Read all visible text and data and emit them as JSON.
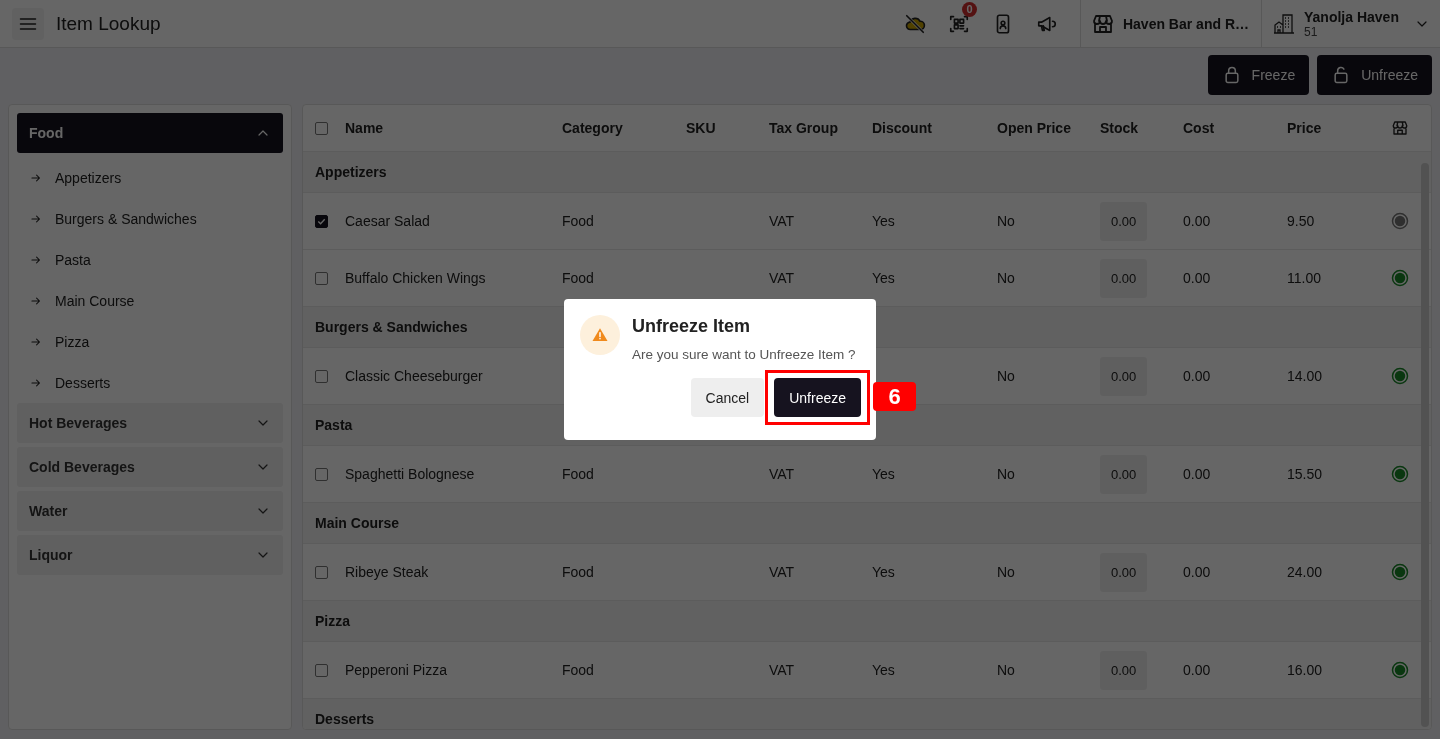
{
  "header": {
    "title": "Item Lookup",
    "notification_count": "0",
    "store": "Haven Bar and R…",
    "account": {
      "name": "Yanolja Haven",
      "number": "51"
    }
  },
  "actions": [
    {
      "label": "Freeze",
      "kind": "lock"
    },
    {
      "label": "Unfreeze",
      "kind": "unlock"
    }
  ],
  "sidebar": {
    "categories": [
      {
        "label": "Food",
        "selected": true,
        "expanded": true,
        "children": [
          {
            "label": "Appetizers"
          },
          {
            "label": "Burgers & Sandwiches"
          },
          {
            "label": "Pasta"
          },
          {
            "label": "Main Course"
          },
          {
            "label": "Pizza"
          },
          {
            "label": "Desserts"
          }
        ]
      },
      {
        "label": "Hot Beverages",
        "selected": false,
        "expanded": false
      },
      {
        "label": "Cold Beverages",
        "selected": false,
        "expanded": false
      },
      {
        "label": "Water",
        "selected": false,
        "expanded": false
      },
      {
        "label": "Liquor",
        "selected": false,
        "expanded": false
      }
    ]
  },
  "table": {
    "columns": [
      "Name",
      "Category",
      "SKU",
      "Tax Group",
      "Discount",
      "Open Price",
      "Stock",
      "Cost",
      "Price"
    ],
    "select_all_checked": false,
    "rows": [
      {
        "kind": "group",
        "label": "Appetizers"
      },
      {
        "kind": "item",
        "checked": true,
        "name": "Caesar Salad",
        "category": "Food",
        "tax_group": "VAT",
        "discount": "Yes",
        "open_price": "No",
        "stock": "0.00",
        "cost": "0.00",
        "price": "9.50",
        "active": false
      },
      {
        "kind": "item",
        "checked": false,
        "name": "Buffalo Chicken Wings",
        "category": "Food",
        "tax_group": "VAT",
        "discount": "Yes",
        "open_price": "No",
        "stock": "0.00",
        "cost": "0.00",
        "price": "11.00",
        "active": true
      },
      {
        "kind": "group",
        "label": "Burgers & Sandwiches"
      },
      {
        "kind": "item",
        "checked": false,
        "name": "Classic Cheeseburger",
        "open_price": "No",
        "stock": "0.00",
        "cost": "0.00",
        "price": "14.00",
        "active": true
      },
      {
        "kind": "group",
        "label": "Pasta"
      },
      {
        "kind": "item",
        "checked": false,
        "name": "Spaghetti Bolognese",
        "category": "Food",
        "tax_group": "VAT",
        "discount": "Yes",
        "open_price": "No",
        "stock": "0.00",
        "cost": "0.00",
        "price": "15.50",
        "active": true
      },
      {
        "kind": "group",
        "label": "Main Course"
      },
      {
        "kind": "item",
        "checked": false,
        "name": "Ribeye Steak",
        "category": "Food",
        "tax_group": "VAT",
        "discount": "Yes",
        "open_price": "No",
        "stock": "0.00",
        "cost": "0.00",
        "price": "24.00",
        "active": true
      },
      {
        "kind": "group",
        "label": "Pizza"
      },
      {
        "kind": "item",
        "checked": false,
        "name": "Pepperoni Pizza",
        "category": "Food",
        "tax_group": "VAT",
        "discount": "Yes",
        "open_price": "No",
        "stock": "0.00",
        "cost": "0.00",
        "price": "16.00",
        "active": true
      },
      {
        "kind": "group",
        "label": "Desserts"
      }
    ]
  },
  "dialog": {
    "title": "Unfreeze Item",
    "message": "Are you sure want to Unfreeze Item ?",
    "buttons": [
      {
        "label": "Cancel",
        "kind": "secondary"
      },
      {
        "label": "Unfreeze",
        "kind": "primary",
        "step_marker": "6"
      }
    ]
  }
}
